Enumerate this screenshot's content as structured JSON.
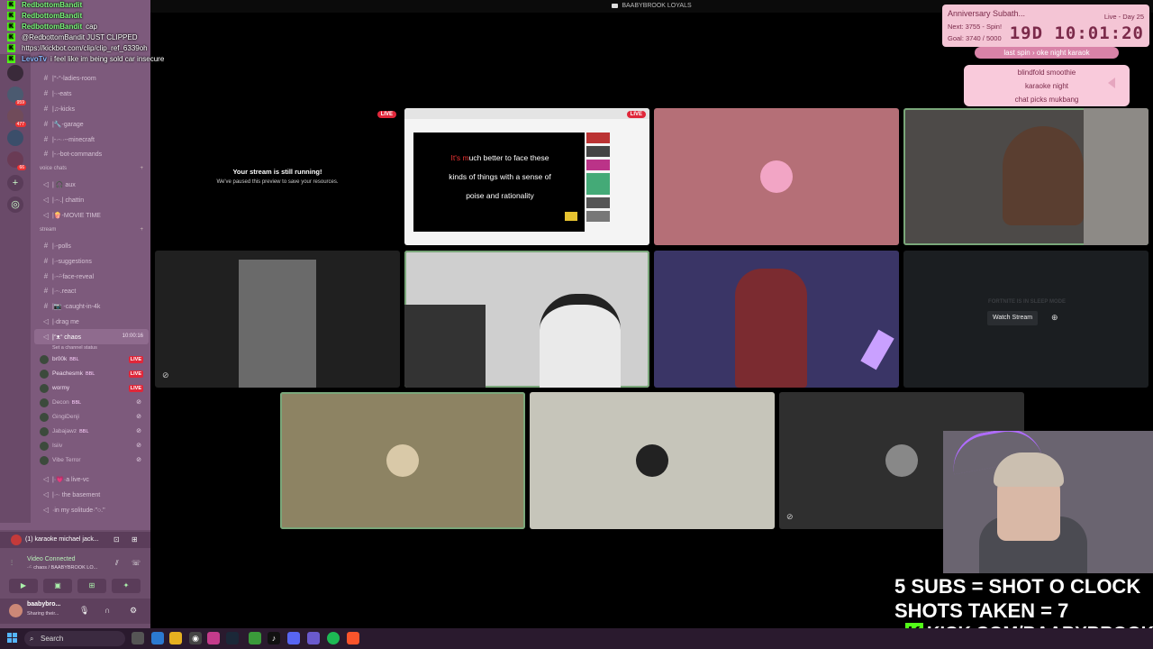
{
  "window": {
    "title": "BAABYBROOK LOYALS"
  },
  "chat": [
    {
      "user": "RedbottomBandit",
      "text": ""
    },
    {
      "user": "RedbottomBandit",
      "text": ""
    },
    {
      "user": "RedbottomBandit",
      "text": "cap"
    },
    {
      "user": "",
      "text": "@RedbottomBandit JUST CLIPPED"
    },
    {
      "user": "",
      "text": "https://kickbot.com/clip/clip_ref_6339oh"
    },
    {
      "user": "LevoTv",
      "text": "i feel like im being sold car insecure"
    }
  ],
  "channels": [
    {
      "type": "text",
      "name": "|°-°-ladies-room"
    },
    {
      "type": "text",
      "name": "|ᐧ·-eats"
    },
    {
      "type": "text",
      "name": "|♫-kicks"
    },
    {
      "type": "text",
      "name": "|🔧-garage"
    },
    {
      "type": "text",
      "name": "|-·-··--minecraft"
    },
    {
      "type": "text",
      "name": "|-·-bot-commands"
    },
    {
      "type": "category",
      "name": "voice chats"
    },
    {
      "type": "voice",
      "name": "| 🎧 aux"
    },
    {
      "type": "voice",
      "name": "|·-·.| chattin"
    },
    {
      "type": "voice",
      "name": "|🍿-MOVIE TIME"
    },
    {
      "type": "category",
      "name": "stream"
    },
    {
      "type": "text",
      "name": "|·-polls"
    },
    {
      "type": "text",
      "name": "|·-suggestions"
    },
    {
      "type": "text",
      "name": "|·-ᵕ̈-face-reveal"
    },
    {
      "type": "text",
      "name": "|·-·.react"
    },
    {
      "type": "text",
      "name": "|📷 -caught-in-4k"
    },
    {
      "type": "voice",
      "name": "|·drag me"
    }
  ],
  "selected_channel": {
    "name": "|ᵔᴥᵔ chaos",
    "time": "10:00:16",
    "status": "Set a channel status"
  },
  "members": [
    {
      "name": "br00k",
      "tag": "BBL",
      "live": "LIVE"
    },
    {
      "name": "Peachesmk",
      "tag": "BBL",
      "live": "LIVE"
    },
    {
      "name": "wormy",
      "tag": "",
      "live": "LIVE"
    },
    {
      "name": "Decon",
      "tag": "BBL",
      "live": ""
    },
    {
      "name": "GingiDenji",
      "tag": "",
      "live": ""
    },
    {
      "name": "Jabajawz",
      "tag": "BBL",
      "live": ""
    },
    {
      "name": "Isiiv",
      "tag": "",
      "live": ""
    },
    {
      "name": "Vibe Terror",
      "tag": "",
      "live": ""
    }
  ],
  "channels_after": [
    {
      "type": "voice",
      "name": "|·💗·a live-vc"
    },
    {
      "type": "voice",
      "name": "|·-· the basement"
    },
    {
      "type": "voice",
      "name": "·in my solitude·\"○.\""
    }
  ],
  "voice_panel": {
    "event": "(1) karaoke michael jack...",
    "connected": "Video Connected",
    "connected_sub": "·ᵕ̈· chaos / BAABYBROOK LO...",
    "user": "baabybro...",
    "user_sub": "Sharing their..."
  },
  "paused": {
    "title": "Your stream is still running!",
    "subtitle": "We've paused this preview to save your resources."
  },
  "live_label": "LIVE",
  "video_caption": {
    "line1_red": "It's m",
    "line1": "uch better to face these",
    "line2": "kinds of things with a sense of",
    "line3": "poise and rationality"
  },
  "sleep_text": "FORTNITE IS IN SLEEP MODE",
  "watch_stream": "Watch Stream",
  "subathon": {
    "title": "Anniversary Subath...",
    "day": "Live - Day 25",
    "next": "Next: 3755 - Spin!",
    "goal": "Goal: 3740 / 5000",
    "timer": "19D 10:01:20"
  },
  "spin": {
    "label": "last spin  ›  oke night karaok"
  },
  "wheel_options": [
    "blindfold smoothie",
    "karaoke night",
    "chat picks mukbang"
  ],
  "overlay": {
    "shots_line1": "5 SUBS = SHOT O CLOCK",
    "shots_line2": "SHOTS TAKEN = 7",
    "kick_url": "KICK.COM/BAABYBROOK",
    "kick_logo": "K"
  },
  "taskbar": {
    "search": "Search"
  },
  "colors": {
    "sidebar": "#7d5a7c",
    "live_red": "#e0273a",
    "kick_green": "#53fc18",
    "subathon_pink": "#f4c5d5"
  }
}
